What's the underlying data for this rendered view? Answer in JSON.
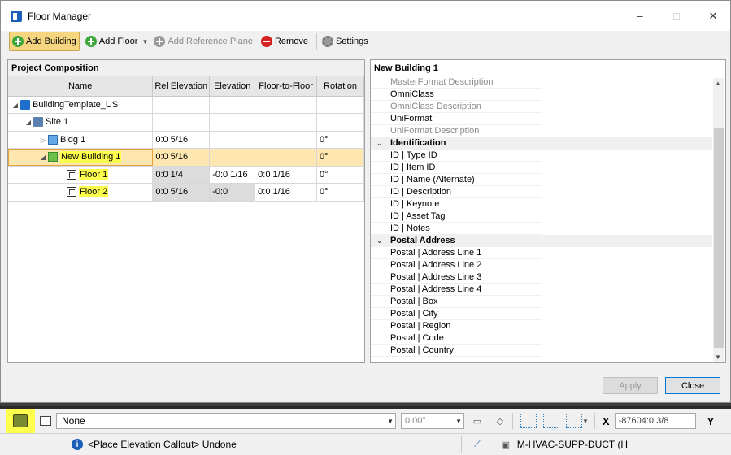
{
  "window": {
    "title": "Floor Manager",
    "minimize": "–",
    "maximize": "□",
    "close": "✕"
  },
  "toolbar": {
    "add_building": "Add Building",
    "add_floor": "Add Floor",
    "add_reference_plane": "Add Reference Plane",
    "remove": "Remove",
    "settings": "Settings"
  },
  "left_panel": {
    "title": "Project Composition",
    "columns": [
      "Name",
      "Rel Elevation",
      "Elevation",
      "Floor-to-Floor",
      "Rotation"
    ],
    "rows": [
      {
        "name": "BuildingTemplate_US",
        "rel_elevation": "",
        "elevation": "",
        "floor_to_floor": "",
        "rotation": ""
      },
      {
        "name": "Site 1",
        "rel_elevation": "",
        "elevation": "",
        "floor_to_floor": "",
        "rotation": ""
      },
      {
        "name": "Bldg 1",
        "rel_elevation": "0:0 5/16",
        "elevation": "",
        "floor_to_floor": "",
        "rotation": "0°"
      },
      {
        "name": "New Building 1",
        "rel_elevation": "0:0 5/16",
        "elevation": "",
        "floor_to_floor": "",
        "rotation": "0°"
      },
      {
        "name": "Floor 1",
        "rel_elevation": "0:0 1/4",
        "elevation": "-0:0 1/16",
        "floor_to_floor": "0:0 1/16",
        "rotation": "0°"
      },
      {
        "name": "Floor 2",
        "rel_elevation": "0:0 5/16",
        "elevation": "-0:0",
        "floor_to_floor": "0:0 1/16",
        "rotation": "0°"
      }
    ]
  },
  "right_panel": {
    "title": "New Building 1",
    "properties": [
      {
        "label": "MasterFormat Description"
      },
      {
        "label": "OmniClass"
      },
      {
        "label": "OmniClass Description"
      },
      {
        "label": "UniFormat"
      },
      {
        "label": "UniFormat Description"
      },
      {
        "label": "Identification"
      },
      {
        "label": "ID | Type ID"
      },
      {
        "label": "ID | Item ID"
      },
      {
        "label": "ID | Name (Alternate)"
      },
      {
        "label": "ID | Description"
      },
      {
        "label": "ID | Keynote"
      },
      {
        "label": "ID | Asset Tag"
      },
      {
        "label": "ID | Notes"
      },
      {
        "label": "Postal Address"
      },
      {
        "label": "Postal | Address Line 1"
      },
      {
        "label": "Postal | Address Line 2"
      },
      {
        "label": "Postal | Address Line 3"
      },
      {
        "label": "Postal | Address Line 4"
      },
      {
        "label": "Postal | Box"
      },
      {
        "label": "Postal | City"
      },
      {
        "label": "Postal | Region"
      },
      {
        "label": "Postal | Code"
      },
      {
        "label": "Postal | Country"
      }
    ]
  },
  "buttons": {
    "apply": "Apply",
    "close": "Close"
  },
  "statusbar": {
    "level": "None",
    "angle": "0.00°",
    "x_label": "X",
    "x_value": "-87604:0 3/8",
    "y_label": "Y",
    "message": "<Place Elevation Callout> Undone",
    "active_level": "M-HVAC-SUPP-DUCT (H"
  }
}
